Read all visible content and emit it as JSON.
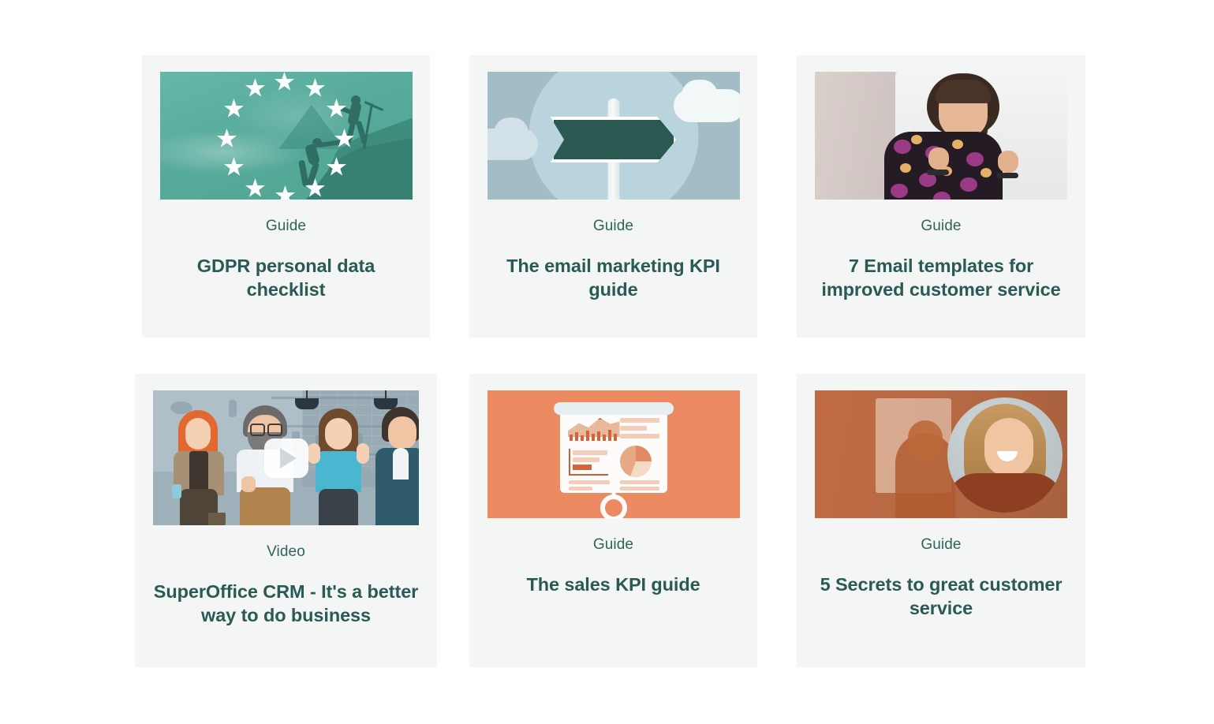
{
  "page": {
    "background_color": "#ffffff",
    "card_background_color": "#f4f5f5",
    "kicker_color": "#2f635d",
    "title_color": "#2a5a55"
  },
  "cards": [
    {
      "kicker": "Guide",
      "title": "GDPR personal data checklist",
      "thumbnail": "gdpr-eu-stars-mountain-climbers-image"
    },
    {
      "kicker": "Guide",
      "title": "The email marketing KPI guide",
      "thumbnail": "signpost-clouds-illustration"
    },
    {
      "kicker": "Guide",
      "title": "7 Email templates for improved customer service",
      "thumbnail": "woman-celebrating-photo"
    },
    {
      "kicker": "Video",
      "title": "SuperOffice CRM - It's a better way to do business",
      "thumbnail": "cartoon-team-video-thumbnail",
      "play_button": "play-icon"
    },
    {
      "kicker": "Guide",
      "title": "The sales KPI guide",
      "thumbnail": "presentation-board-charts-illustration"
    },
    {
      "kicker": "Guide",
      "title": "5 Secrets to great customer service",
      "thumbnail": "woman-laughing-photo"
    }
  ]
}
